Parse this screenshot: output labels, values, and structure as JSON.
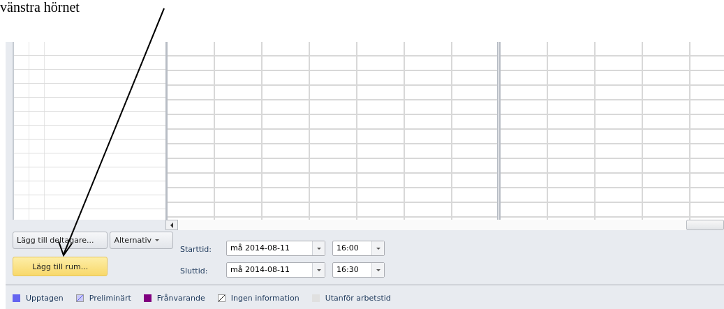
{
  "annotation": {
    "text": "vänstra hörnet"
  },
  "buttons": [
    {
      "label": "Lägg till deltagare...",
      "kind": "plain"
    },
    {
      "label": "Alternativ",
      "kind": "dropdown"
    },
    {
      "label": "Lägg till rum...",
      "kind": "highlighted"
    }
  ],
  "times": [
    {
      "label": "Starttid:",
      "date": "må 2014-08-11",
      "time": "16:00"
    },
    {
      "label": "Sluttid:",
      "date": "må 2014-08-11",
      "time": "16:30"
    }
  ],
  "legend": [
    {
      "label": "Upptagen",
      "kind": "solid",
      "color": "#6464f0"
    },
    {
      "label": "Preliminärt",
      "kind": "hatched",
      "color": "#c8c8f8"
    },
    {
      "label": "Frånvarande",
      "kind": "solid",
      "color": "#800080"
    },
    {
      "label": "Ingen information",
      "kind": "hatched",
      "color": "#ffffff"
    },
    {
      "label": "Utanför arbetstid",
      "kind": "solid",
      "color": "#e0e0e0"
    }
  ]
}
